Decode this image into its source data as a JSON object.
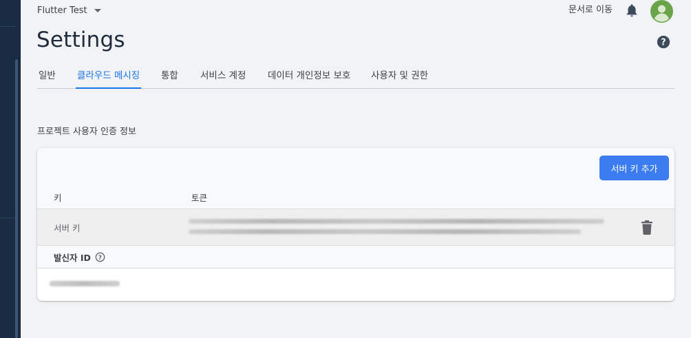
{
  "header": {
    "project_name": "Flutter Test",
    "goto_docs_label": "문서로 이동",
    "bell_icon": "notifications-icon",
    "avatar_icon": "account-avatar"
  },
  "page": {
    "title": "Settings",
    "help_icon": "help-circle-icon"
  },
  "tabs": [
    {
      "label": "일반",
      "active": false
    },
    {
      "label": "클라우드 메시징",
      "active": true
    },
    {
      "label": "통합",
      "active": false
    },
    {
      "label": "서비스 계정",
      "active": false
    },
    {
      "label": "데이터 개인정보 보호",
      "active": false
    },
    {
      "label": "사용자 및 권한",
      "active": false
    }
  ],
  "credentials": {
    "section_title": "프로젝트 사용자 인증 정보",
    "add_key_label": "서버 키 추가",
    "columns": {
      "key": "키",
      "token": "토큰"
    },
    "rows": [
      {
        "key": "서버 키",
        "token": "(redacted)",
        "delete_icon": "trash-icon"
      }
    ],
    "sender_id_label": "발신자 ID",
    "sender_help_icon": "help-circle-icon",
    "sender_id_value": "(redacted)"
  },
  "colors": {
    "accent": "#1a73e8",
    "button": "#3b7cf0",
    "sidebar": "#1a2c44"
  }
}
